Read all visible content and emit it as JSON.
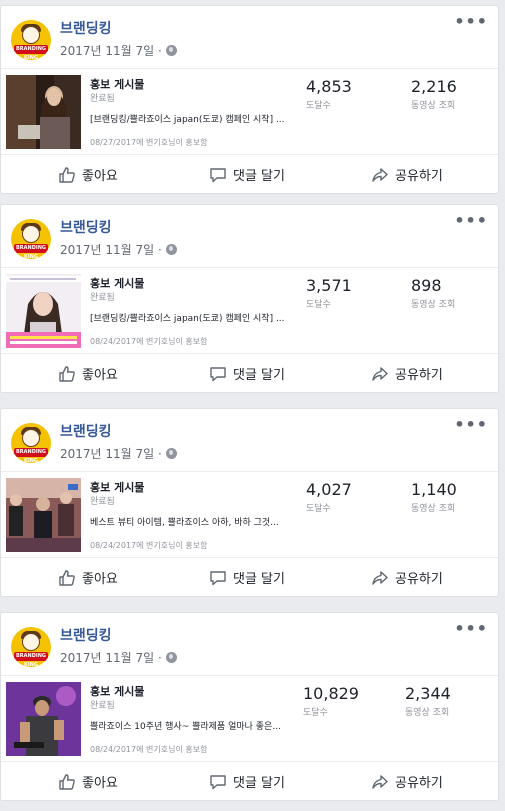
{
  "posts": [
    {
      "page_name": "브랜딩킹",
      "date": "2017년 11월 7일 ·",
      "avatar_text": "BRANDING KING",
      "promo_title": "홍보 게시물",
      "promo_status": "완료됨",
      "promo_desc": "[브랜딩킹/쁠라죠이스 japan(도쿄) 캠페인 시작] ...",
      "promo_date": "08/27/2017에 변기호님이 홍보함",
      "reach": "4,853",
      "reach_label": "도달수",
      "views": "2,216",
      "views_label": "동영상 조회",
      "like": "좋아요",
      "comment": "댓글 달기",
      "share": "공유하기"
    },
    {
      "page_name": "브랜딩킹",
      "date": "2017년 11월 7일 ·",
      "avatar_text": "BRANDING KING",
      "promo_title": "홍보 게시물",
      "promo_status": "완료됨",
      "promo_desc": "[브랜딩킹/쁠라죠이스 japan(도쿄) 캠페인 시작] ...",
      "promo_date": "08/24/2017에 변기호님이 홍보함",
      "reach": "3,571",
      "reach_label": "도달수",
      "views": "898",
      "views_label": "동영상 조회",
      "like": "좋아요",
      "comment": "댓글 달기",
      "share": "공유하기"
    },
    {
      "page_name": "브랜딩킹",
      "date": "2017년 11월 7일 ·",
      "avatar_text": "BRANDING KING",
      "promo_title": "홍보 게시물",
      "promo_status": "완료됨",
      "promo_desc": "베스트 뷰티 아이템, 쁠라죠이스 아하, 바하 그것...",
      "promo_date": "08/24/2017에 변기호님이 홍보함",
      "reach": "4,027",
      "reach_label": "도달수",
      "views": "1,140",
      "views_label": "동영상 조회",
      "like": "좋아요",
      "comment": "댓글 달기",
      "share": "공유하기"
    },
    {
      "page_name": "브랜딩킹",
      "date": "2017년 11월 7일 ·",
      "avatar_text": "BRANDING KING",
      "promo_title": "홍보 게시물",
      "promo_status": "완료됨",
      "promo_desc": "쁠라죠이스 10주년 행사~ 쁠라제품 얼마나 좋은...",
      "promo_date": "08/24/2017에 변기호님이 홍보함",
      "reach": "10,829",
      "reach_label": "도달수",
      "views": "2,344",
      "views_label": "동영상 조회",
      "like": "좋아요",
      "comment": "댓글 달기",
      "share": "공유하기"
    }
  ],
  "more_icon": "more-horizontal-icon",
  "globe_icon": "globe-icon",
  "like_icon": "thumbs-up-icon",
  "comment_icon": "speech-bubble-icon",
  "share_icon": "share-arrow-icon"
}
